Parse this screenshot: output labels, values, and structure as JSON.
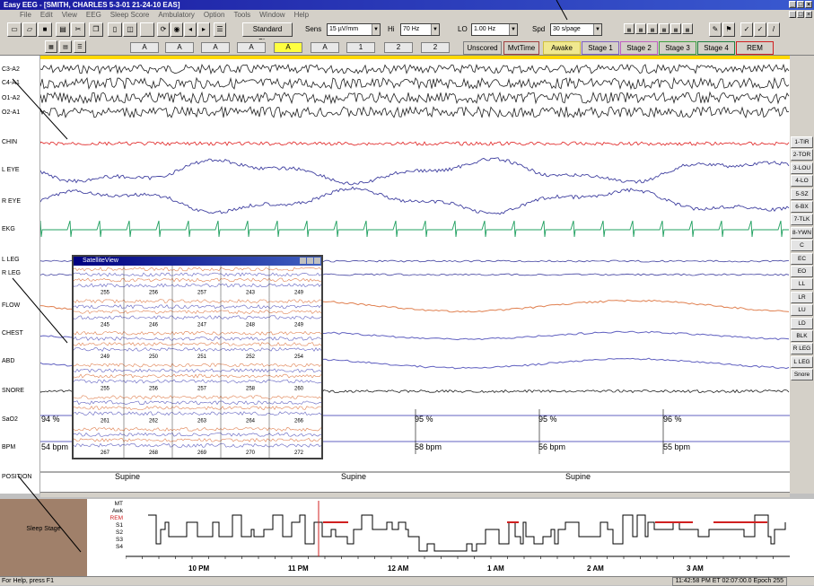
{
  "window": {
    "title": "Easy EEG - [SMITH, CHARLES 5-3-01 21-24-10 EAS]",
    "controls": [
      "_",
      "□",
      "×"
    ]
  },
  "menu": [
    "File",
    "Edit",
    "View",
    "EEG",
    "Sleep Score",
    "Ambulatory",
    "Option",
    "Tools",
    "Window",
    "Help"
  ],
  "toolbar": {
    "montage": "Standard Sleep",
    "sens_label": "Sens",
    "sens_value": "15 µV/mm",
    "hi_label": "Hi",
    "hi_value": "70 Hz",
    "lo_label": "LO",
    "lo_value": "1.00 Hz",
    "spd_label": "Spd",
    "spd_value": "30 s/page"
  },
  "channel_toggles": [
    "A",
    "A",
    "A",
    "A",
    "A",
    "A",
    "1",
    "2",
    "2"
  ],
  "stage_buttons": [
    {
      "label": "Unscored",
      "color": "#808080"
    },
    {
      "label": "MvtTime",
      "color": "#a04040"
    },
    {
      "label": "Awake",
      "color": "#d0c040"
    },
    {
      "label": "Stage 1",
      "color": "#8060c0"
    },
    {
      "label": "Stage 2",
      "color": "#c060c0"
    },
    {
      "label": "Stage 3",
      "color": "#40a040"
    },
    {
      "label": "Stage 4",
      "color": "#208040"
    },
    {
      "label": "REM",
      "color": "#d02020"
    }
  ],
  "channels": [
    "C3-A2",
    "C4-A1",
    "O1-A2",
    "O2-A1",
    "CHIN",
    "L EYE",
    "R EYE",
    "EKG",
    "L LEG",
    "R LEG",
    "FLOW",
    "CHEST",
    "ABD",
    "SNORE",
    "SaO2",
    "BPM",
    "POSITION"
  ],
  "right_panel": [
    "1-TIR",
    "2-TOR",
    "3-LOU",
    "4-LO",
    "5-SZ",
    "6-BX",
    "7-TLK",
    "8-YWN",
    "C",
    "EC",
    "EO",
    "LL",
    "LR",
    "LU",
    "LD",
    "BLK",
    "R LEG",
    "L LEG",
    "Snore"
  ],
  "readouts": {
    "sao2": [
      "94 %",
      "95 %",
      "95 %",
      "96 %"
    ],
    "bpm": [
      "54 bpm",
      "58 bpm",
      "56 bpm",
      "55 bpm"
    ],
    "position": [
      "Supine",
      "Supine",
      "Supine"
    ]
  },
  "satellite": {
    "title": "SatelliteView",
    "epochs": [
      [
        "255",
        "256",
        "257",
        "243",
        "249"
      ],
      [
        "245",
        "246",
        "247",
        "248",
        "249"
      ],
      [
        "249",
        "250",
        "251",
        "252",
        "254"
      ],
      [
        "255",
        "256",
        "257",
        "258",
        "260"
      ],
      [
        "261",
        "262",
        "263",
        "264",
        "266"
      ],
      [
        "267",
        "268",
        "269",
        "270",
        "272"
      ]
    ]
  },
  "hypnogram": {
    "label": "Sleep Stage",
    "stages": [
      "MT",
      "Awk",
      "REM",
      "S1",
      "S2",
      "S3",
      "S4"
    ],
    "times": [
      "10 PM",
      "11 PM",
      "12 AM",
      "1 AM",
      "2 AM",
      "3 AM"
    ]
  },
  "status": {
    "help": "For Help, press F1",
    "info": "11:42:58 PM  ET 02:07:00.0  Epoch 255"
  },
  "colors": {
    "eeg": "#202020",
    "chin": "#e02020",
    "eye": "#4040a0",
    "ekg": "#20a060",
    "flow": "#e08050",
    "resp": "#6060c0",
    "rem": "#d02020",
    "highlight": "#ffd800"
  }
}
